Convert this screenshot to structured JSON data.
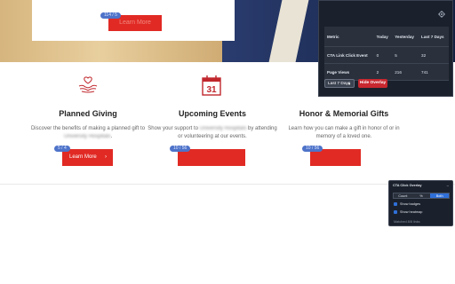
{
  "hero": {
    "button_label": "Learn More",
    "badge": "114 / 5"
  },
  "overlay": {
    "settings_icon": "gear-icon",
    "table": {
      "headers": [
        "Metric",
        "Today",
        "Yesterday",
        "Last 7 Days"
      ],
      "rows": [
        [
          "CTA Link Click Event",
          "0",
          "5",
          "32"
        ],
        [
          "Page Views",
          "2",
          "216",
          "741"
        ]
      ]
    },
    "range_value": "Last 7 Days",
    "hide_label": "Hide Overlay"
  },
  "cards": [
    {
      "icon": "giving-hands-icon",
      "title": "Planned Giving",
      "desc_pre": "Discover the benefits of making a planned gift to",
      "desc_blur": "University Hospitals",
      "desc_post": ".",
      "button": "Learn More",
      "badge": "5 / 4"
    },
    {
      "icon": "calendar-icon",
      "calendar_number": "31",
      "title": "Upcoming Events",
      "desc_pre": "Show your support to",
      "desc_blur": "University Hospitals",
      "desc_post": "by attending or volunteering at our events.",
      "button": "",
      "badge": "10 / 56"
    },
    {
      "title": "Honor & Memorial Gifts",
      "desc_pre": "Learn how you can make a gift in honor of or in memory of a loved one.",
      "desc_blur": "",
      "desc_post": "",
      "button": "",
      "badge": "10 / 56"
    }
  ],
  "widget": {
    "title": "CTA Click Overlay",
    "minimize": "–",
    "segments": [
      "Count",
      "%",
      "Both"
    ],
    "active_segment": "Both",
    "checkbox_1": "Show badges",
    "checkbox_2": "Show heatmap",
    "footer": "Matched 8/8 links"
  },
  "colors": {
    "cta_red": "#e12a24",
    "badge_blue": "#4e73c9",
    "panel_dark": "#1b212c",
    "accent_blue": "#2f6fd8"
  }
}
